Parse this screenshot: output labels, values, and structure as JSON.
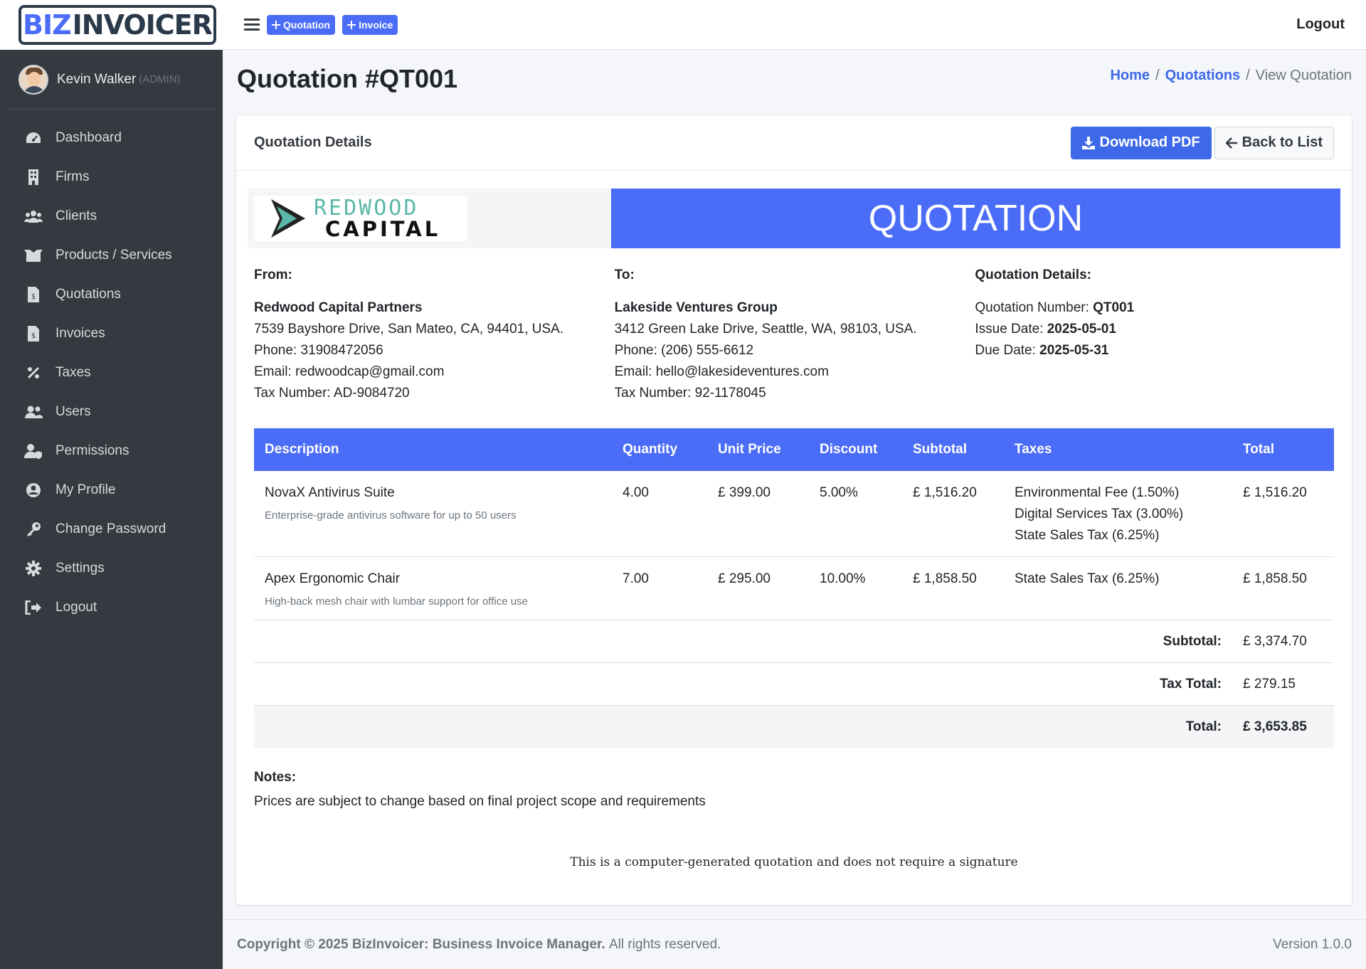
{
  "brand": {
    "part1": "BIZ",
    "part2": "INVOICER"
  },
  "user": {
    "name": "Kevin Walker",
    "role": "(ADMIN)"
  },
  "sidebar": {
    "items": [
      {
        "label": "Dashboard",
        "icon": "dashboard-icon"
      },
      {
        "label": "Firms",
        "icon": "building-icon"
      },
      {
        "label": "Clients",
        "icon": "users-icon"
      },
      {
        "label": "Products / Services",
        "icon": "box-icon"
      },
      {
        "label": "Quotations",
        "icon": "file-invoice-icon"
      },
      {
        "label": "Invoices",
        "icon": "file-invoice-icon"
      },
      {
        "label": "Taxes",
        "icon": "percent-icon"
      },
      {
        "label": "Users",
        "icon": "users-icon"
      },
      {
        "label": "Permissions",
        "icon": "user-shield-icon"
      },
      {
        "label": "My Profile",
        "icon": "user-circle-icon"
      },
      {
        "label": "Change Password",
        "icon": "key-icon"
      },
      {
        "label": "Settings",
        "icon": "gear-icon"
      },
      {
        "label": "Logout",
        "icon": "sign-out-icon"
      }
    ]
  },
  "topbar": {
    "quotation_btn": "Quotation",
    "invoice_btn": "Invoice",
    "logout": "Logout"
  },
  "page": {
    "title": "Quotation #QT001",
    "breadcrumb": {
      "home": "Home",
      "quotations": "Quotations",
      "current": "View Quotation"
    }
  },
  "card": {
    "title": "Quotation Details",
    "download_pdf": "Download PDF",
    "back_to_list": "Back to List"
  },
  "document": {
    "logo": {
      "line1": "REDWOOD",
      "line2": "CAPITAL"
    },
    "banner": "QUOTATION",
    "from": {
      "heading": "From:",
      "name": "Redwood Capital Partners",
      "address": "7539 Bayshore Drive, San Mateo, CA, 94401, USA.",
      "phone": "Phone: 31908472056",
      "email": "Email: redwoodcap@gmail.com",
      "tax": "Tax Number: AD-9084720"
    },
    "to": {
      "heading": "To:",
      "name": "Lakeside Ventures Group",
      "address": "3412 Green Lake Drive, Seattle, WA, 98103, USA.",
      "phone": "Phone: (206) 555-6612",
      "email": "Email: hello@lakesideventures.com",
      "tax": "Tax Number: 92-1178045"
    },
    "details": {
      "heading": "Quotation Details:",
      "number_label": "Quotation Number:",
      "number": "QT001",
      "issue_label": "Issue Date:",
      "issue": "2025-05-01",
      "due_label": "Due Date:",
      "due": "2025-05-31"
    },
    "table": {
      "headers": [
        "Description",
        "Quantity",
        "Unit Price",
        "Discount",
        "Subtotal",
        "Taxes",
        "Total"
      ],
      "rows": [
        {
          "name": "NovaX Antivirus Suite",
          "desc": "Enterprise-grade antivirus software for up to 50 users",
          "qty": "4.00",
          "unit": "£ 399.00",
          "discount": "5.00%",
          "subtotal": "£ 1,516.20",
          "taxes": [
            "Environmental Fee (1.50%)",
            "Digital Services Tax (3.00%)",
            "State Sales Tax (6.25%)"
          ],
          "total": "£ 1,516.20"
        },
        {
          "name": "Apex Ergonomic Chair",
          "desc": "High-back mesh chair with lumbar support for office use",
          "qty": "7.00",
          "unit": "£ 295.00",
          "discount": "10.00%",
          "subtotal": "£ 1,858.50",
          "taxes": [
            "State Sales Tax (6.25%)"
          ],
          "total": "£ 1,858.50"
        }
      ],
      "summary": {
        "subtotal_label": "Subtotal:",
        "subtotal": "£ 3,374.70",
        "tax_label": "Tax Total:",
        "tax": "£ 279.15",
        "total_label": "Total:",
        "total": "£ 3,653.85"
      }
    },
    "notes": {
      "heading": "Notes:",
      "text": "Prices are subject to change based on final project scope and requirements"
    },
    "footnote": "This is a computer-generated quotation and does not require a signature"
  },
  "footer": {
    "copyright": "Copyright © 2025 BizInvoicer: Business Invoice Manager.",
    "rights": "All rights reserved.",
    "version": "Version 1.0.0"
  },
  "colors": {
    "accent": "#4a6cf7",
    "sidebar": "#343a40",
    "link": "#3d68e8"
  }
}
